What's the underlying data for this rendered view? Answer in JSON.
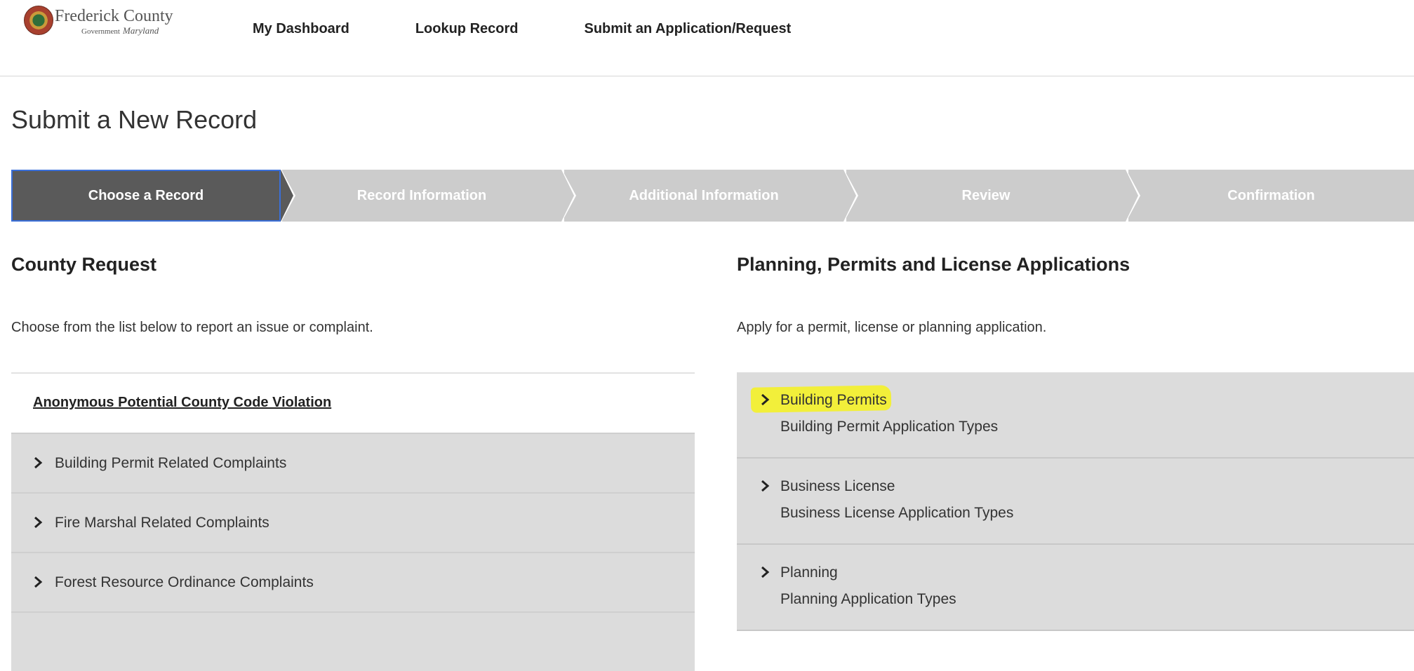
{
  "header": {
    "logo": {
      "name": "Frederick County",
      "sub_prefix": "Government",
      "sub_script": "Maryland"
    },
    "nav": [
      "My Dashboard",
      "Lookup Record",
      "Submit an Application/Request"
    ]
  },
  "page_title": "Submit a New Record",
  "steps": [
    "Choose a Record",
    "Record Information",
    "Additional Information",
    "Review",
    "Confirmation"
  ],
  "active_step": "Choose a Record",
  "county_request": {
    "heading": "County Request",
    "description": "Choose from the list below to report an issue or complaint.",
    "link": "Anonymous Potential County Code Violation",
    "items": [
      "Building Permit Related Complaints",
      "Fire Marshal Related Complaints",
      "Forest Resource Ordinance Complaints"
    ]
  },
  "planning": {
    "heading": "Planning, Permits and License Applications",
    "description": "Apply for a permit, license or planning application.",
    "items": [
      {
        "label": "Building Permits",
        "sub": "Building Permit Application Types"
      },
      {
        "label": "Business License",
        "sub": "Business License Application Types"
      },
      {
        "label": "Planning",
        "sub": "Planning Application Types"
      }
    ]
  },
  "colors": {
    "active_step": "#5a5a5a",
    "inactive_step": "#cccccc",
    "panel_gray": "#dcdcdc",
    "highlight": "#f2ef3a"
  }
}
